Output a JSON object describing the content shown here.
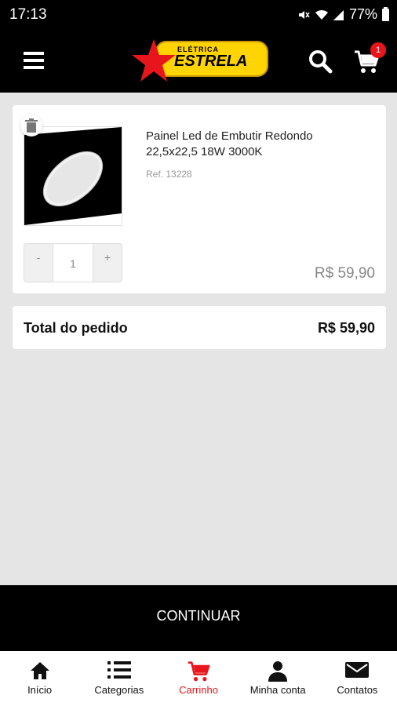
{
  "status_bar": {
    "time": "17:13",
    "battery": "77%"
  },
  "header": {
    "logo_small": "ELÉTRICA",
    "logo_big": "ESTRELA",
    "cart_count": "1"
  },
  "cart": {
    "item": {
      "name": "Painel Led de Embutir Redondo 22,5x22,5 18W 3000K",
      "ref": "Ref. 13228",
      "qty": "1",
      "minus": "-",
      "plus": "+",
      "price": "R$ 59,90"
    },
    "total_label": "Total do pedido",
    "total_value": "R$ 59,90"
  },
  "continue_label": "CONTINUAR",
  "bottom_nav": [
    {
      "label": "Início",
      "icon": "home-icon"
    },
    {
      "label": "Categorias",
      "icon": "list-icon"
    },
    {
      "label": "Carrinho",
      "icon": "cart-icon"
    },
    {
      "label": "Minha conta",
      "icon": "user-icon"
    },
    {
      "label": "Contatos",
      "icon": "envelope-icon"
    }
  ],
  "colors": {
    "brand_red": "#e8161c",
    "brand_yellow": "#ffd400",
    "header_bg": "#000000"
  }
}
